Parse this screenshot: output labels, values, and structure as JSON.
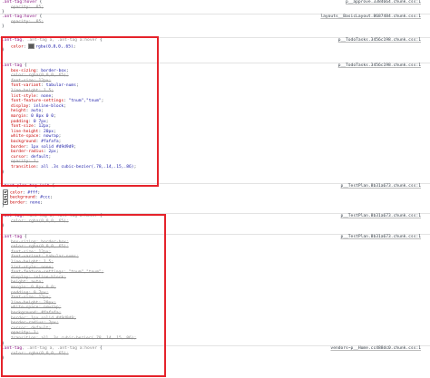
{
  "rules": [
    {
      "selector": ".ant-tag:hover",
      "source": "p__approve.3384664.chunk.css:1",
      "declarations": [
        {
          "name": "opacity",
          "value": ".85",
          "struck": true
        }
      ]
    },
    {
      "selector": ".ant-tag:hover",
      "source": "layouts__BasicLayout.8687484.chunk.css:1",
      "declarations": [
        {
          "name": "opacity",
          "value": ".85",
          "struck": true
        }
      ]
    },
    {
      "selector_main": ".ant-tag",
      "selector_rest": ", .ant-tag a, .ant-tag a:hover",
      "source": "p__TodoTasks.3456c198.chunk.css:1",
      "declarations": [
        {
          "name": "color",
          "value": "rgba(0,0,0,.65)",
          "swatch": true
        }
      ]
    },
    {
      "selector": ".ant-tag",
      "source": "p__TodoTasks.3456c198.chunk.css:1",
      "declarations": [
        {
          "name": "box-sizing",
          "value": "border-box"
        },
        {
          "name": "color",
          "value": "rgba(0,0,0,.65)",
          "struck": true
        },
        {
          "name": "font-size",
          "value": "12px",
          "struck": true
        },
        {
          "name": "font-variant",
          "value": "tabular-nums"
        },
        {
          "name": "line-height",
          "value": "1.5",
          "struck": true
        },
        {
          "name": "list-style",
          "value": "none"
        },
        {
          "name": "font-feature-settings",
          "value": "\"tnum\",\"tnum\""
        },
        {
          "name": "display",
          "value": "inline-block"
        },
        {
          "name": "height",
          "value": "auto"
        },
        {
          "name": "margin",
          "value": "0 8px 0 0"
        },
        {
          "name": "padding",
          "value": "0 7px"
        },
        {
          "name": "font-size",
          "value": "12px"
        },
        {
          "name": "line-height",
          "value": "20px"
        },
        {
          "name": "white-space",
          "value": "nowrap"
        },
        {
          "name": "background",
          "value": "#fafafa"
        },
        {
          "name": "border",
          "value": "1px solid #d9d9d9"
        },
        {
          "name": "border-radius",
          "value": "2px"
        },
        {
          "name": "cursor",
          "value": "default"
        },
        {
          "name": "opacity",
          "value": "1",
          "struck": true
        },
        {
          "name": "transition",
          "value": "all .3s cubic-bezier(.78,.14,.15,.86)"
        }
      ]
    },
    {
      "selector": ".test-plan-tag-init",
      "source": "p__TestPlan.8b31a673.chunk.css:1",
      "declarations": [
        {
          "name": "color",
          "value": "#fff",
          "checkbox": true
        },
        {
          "name": "background",
          "value": "#ccc",
          "checkbox": true
        },
        {
          "name": "border",
          "value": "none",
          "checkbox": true
        }
      ]
    },
    {
      "selector_main": ".ant-tag",
      "selector_rest": ", .ant-tag a, .ant-tag a:hover",
      "source": "p__TestPlan.8b31a673.chunk.css:1",
      "declarations": [
        {
          "name": "color",
          "value": "rgba(0,0,0,.65)",
          "struck": true
        }
      ]
    },
    {
      "selector": ".ant-tag",
      "source": "p__TestPlan.8b31a673.chunk.css:1",
      "declarations": [
        {
          "name": "box-sizing",
          "value": "border-box",
          "struck": true
        },
        {
          "name": "color",
          "value": "rgba(0,0,0,.65)",
          "struck": true
        },
        {
          "name": "font-size",
          "value": "12px",
          "struck": true
        },
        {
          "name": "font-variant",
          "value": "tabular-nums",
          "struck": true
        },
        {
          "name": "line-height",
          "value": "1.5",
          "struck": true
        },
        {
          "name": "list-style",
          "value": "none",
          "struck": true
        },
        {
          "name": "font-feature-settings",
          "value": "\"tnum\",\"tnum\"",
          "struck": true
        },
        {
          "name": "display",
          "value": "inline-block",
          "struck": true
        },
        {
          "name": "height",
          "value": "auto",
          "struck": true
        },
        {
          "name": "margin",
          "value": "0 8px 0 0",
          "struck": true
        },
        {
          "name": "padding",
          "value": "0 7px",
          "struck": true
        },
        {
          "name": "font-size",
          "value": "12px",
          "struck": true
        },
        {
          "name": "line-height",
          "value": "20px",
          "struck": true
        },
        {
          "name": "white-space",
          "value": "nowrap",
          "struck": true
        },
        {
          "name": "background",
          "value": "#fafafa",
          "struck": true
        },
        {
          "name": "border",
          "value": "1px solid #d9d9d9",
          "struck": true
        },
        {
          "name": "border-radius",
          "value": "2px",
          "struck": true
        },
        {
          "name": "cursor",
          "value": "default",
          "struck": true
        },
        {
          "name": "opacity",
          "value": "1",
          "struck": true
        },
        {
          "name": "transition",
          "value": "all .3s cubic-bezier(.78,.14,.15,.86)",
          "struck": true
        }
      ]
    },
    {
      "selector_main": ".ant-tag",
      "selector_rest": ", .ant-tag a, .ant-tag a:hover",
      "source": "vendors~p__Home.cc488dc0.chunk.css:1",
      "declarations": [
        {
          "name": "color",
          "value": "rgba(0,0,0,.65)",
          "struck": true
        }
      ]
    }
  ],
  "colors": {
    "highlight": "#e5232b",
    "property": "#c80000",
    "value": "#1a1aa6",
    "selector": "#881280"
  }
}
